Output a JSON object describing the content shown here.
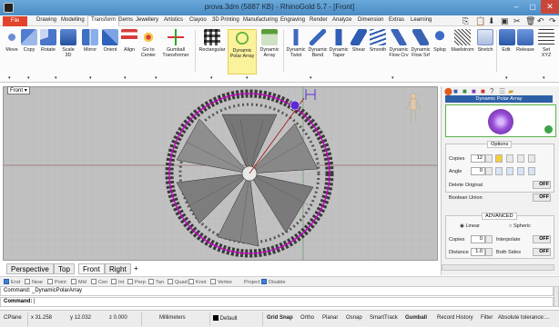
{
  "window": {
    "title": "prova.3dm (5887 KB) - RhinoGold 5.7 - [Front]",
    "app_icon": "rhino-app-icon"
  },
  "menu": {
    "file": "File",
    "items": [
      "Drawing",
      "Modelling",
      "Transform",
      "Gems",
      "Jewellery",
      "Artistics",
      "Clayoo",
      "3D Printing",
      "Manufacturing",
      "Engraving",
      "Render",
      "Analyze",
      "Dimension",
      "Extras",
      "Learning"
    ],
    "active": "Transform"
  },
  "ribbon": {
    "buttons": [
      {
        "label": "Move"
      },
      {
        "label": "Copy"
      },
      {
        "label": "Rotate"
      },
      {
        "label": "Scale\n3D"
      },
      {
        "label": "Mirror"
      },
      {
        "label": "Orient"
      },
      {
        "label": "Align"
      },
      {
        "label": "Go to\nCenter"
      },
      {
        "label": "Gumball\nTransformer"
      },
      {
        "label": "Rectangular"
      },
      {
        "label": "Dynamic\nPolar Array"
      },
      {
        "label": "Dynamic\nArray"
      },
      {
        "label": "Dynamic\nTwist"
      },
      {
        "label": "Dynamic\nBend"
      },
      {
        "label": "Dynamic\nTaper"
      },
      {
        "label": "Shear"
      },
      {
        "label": "Smooth"
      },
      {
        "label": "Dynamic\nFlow Crv"
      },
      {
        "label": "Dynamic\nFlow Srf"
      },
      {
        "label": "Splop"
      },
      {
        "label": "Maelstrom"
      },
      {
        "label": "Stretch"
      },
      {
        "label": "Edit"
      },
      {
        "label": "Release"
      },
      {
        "label": "Set\nXYZ"
      }
    ],
    "highlighted": "Dynamic\nPolar Array"
  },
  "viewport": {
    "label": "Front"
  },
  "view_tabs": [
    "Perspective",
    "Top",
    "Front",
    "Right"
  ],
  "osnap": {
    "items": [
      {
        "label": "End",
        "checked": true
      },
      {
        "label": "Near",
        "checked": false
      },
      {
        "label": "Point",
        "checked": false
      },
      {
        "label": "Mid",
        "checked": false
      },
      {
        "label": "Cen",
        "checked": false
      },
      {
        "label": "Int",
        "checked": false
      },
      {
        "label": "Perp",
        "checked": false
      },
      {
        "label": "Tan",
        "checked": false
      },
      {
        "label": "Quad",
        "checked": false
      },
      {
        "label": "Knot",
        "checked": false
      },
      {
        "label": "Vertex",
        "checked": false
      }
    ],
    "project": "Project",
    "disable": "Disable"
  },
  "command": {
    "history": "Command: _DynamicPolarArray",
    "prompt": "Command:"
  },
  "status": {
    "cplane": "CPlane",
    "x": "x 31.258",
    "y": "y 12.032",
    "z": "z 0.000",
    "units": "Millimeters",
    "layer": "Default",
    "toggles": [
      "Grid Snap",
      "Ortho",
      "Planar",
      "Osnap",
      "SmartTrack",
      "Gumball",
      "Record History",
      "Filter",
      "Absolute tolerance:..."
    ]
  },
  "panel": {
    "title": "Dynamic Polar Array",
    "options_label": "Options",
    "copies_label": "Copies",
    "copies": "12",
    "angle_label": "Angle",
    "angle": "0",
    "delete_original": "Delete Original",
    "boolean_union": "Boolean Union",
    "off": "OFF",
    "advanced_label": "ADVANCED",
    "linear": "Linear",
    "spheric": "Spheric",
    "copies2": "0",
    "interpolate": "Interpolate",
    "distance_label": "Distance",
    "distance": "1.0",
    "both_sides": "Both Sides"
  },
  "colors": {
    "accent": "#2d5fa6",
    "file_button": "#e1442a",
    "viewport_bg": "#c1c1c1",
    "selection": "#cc00cc"
  }
}
